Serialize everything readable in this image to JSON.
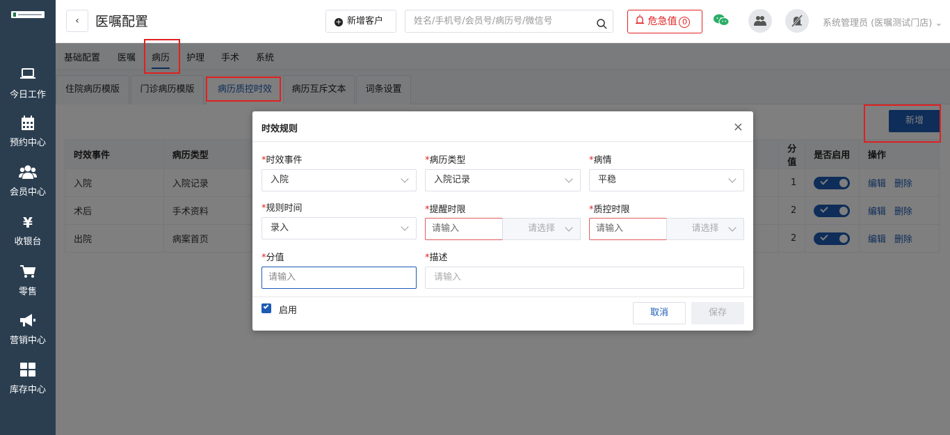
{
  "sidebar": {
    "items": [
      {
        "label": "今日工作",
        "icon": "laptop-icon"
      },
      {
        "label": "预约中心",
        "icon": "calendar-icon"
      },
      {
        "label": "会员中心",
        "icon": "users-icon"
      },
      {
        "label": "收银台",
        "icon": "yen-icon"
      },
      {
        "label": "零售",
        "icon": "cart-icon"
      },
      {
        "label": "营销中心",
        "icon": "megaphone-icon"
      },
      {
        "label": "库存中心",
        "icon": "grid-icon"
      }
    ]
  },
  "header": {
    "title": "医嘱配置",
    "add_customer": "新增客户",
    "search_placeholder": "姓名/手机号/会员号/病历号/微信号",
    "alarm_label": "危急值",
    "alarm_count": "0",
    "user": "系统管理员 (医嘱测试门店)"
  },
  "menu_tabs": [
    "基础配置",
    "医嘱",
    "病历",
    "护理",
    "手术",
    "系统"
  ],
  "sub_tabs": [
    "住院病历模版",
    "门诊病历模版",
    "病历质控时效",
    "病历互斥文本",
    "词条设置"
  ],
  "toolbar": {
    "new_label": "新增"
  },
  "table": {
    "headers": [
      "时效事件",
      "病历类型",
      "分值",
      "是否启用",
      "操作"
    ],
    "rows": [
      {
        "event": "入院",
        "type": "入院记录",
        "score": "1",
        "edit": "编辑",
        "del": "删除"
      },
      {
        "event": "术后",
        "type": "手术资料",
        "score": "2",
        "edit": "编辑",
        "del": "删除"
      },
      {
        "event": "出院",
        "type": "病案首页",
        "score": "2",
        "edit": "编辑",
        "del": "删除"
      }
    ]
  },
  "dialog": {
    "title": "时效规则",
    "fields": {
      "event": {
        "label": "时效事件",
        "value": "入院"
      },
      "record_type": {
        "label": "病历类型",
        "value": "入院记录"
      },
      "condition": {
        "label": "病情",
        "value": "平稳"
      },
      "rule_time": {
        "label": "规则时间",
        "value": "录入"
      },
      "remind": {
        "label": "提醒时限",
        "placeholder": "请输入",
        "unit_placeholder": "请选择"
      },
      "qc": {
        "label": "质控时限",
        "placeholder": "请输入",
        "unit_placeholder": "请选择"
      },
      "score": {
        "label": "分值",
        "placeholder": "请输入"
      },
      "desc": {
        "label": "描述",
        "placeholder": "请输入"
      }
    },
    "enable_label": "启用",
    "cancel": "取消",
    "save": "保存"
  },
  "colors": {
    "primary": "#1c5ab3",
    "sidebar": "#2b3e50",
    "danger": "#e02020"
  }
}
